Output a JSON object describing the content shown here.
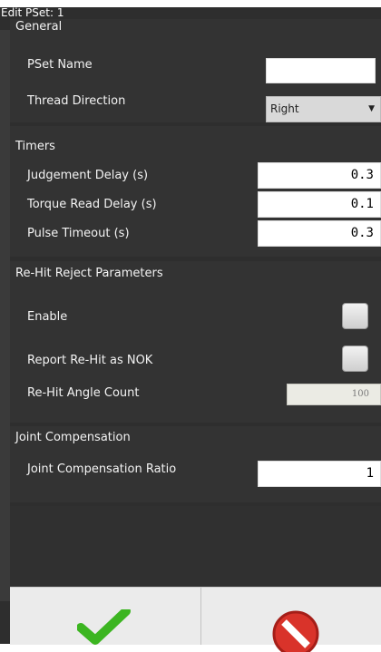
{
  "dialog": {
    "title": "Edit PSet: 1"
  },
  "general": {
    "header": "General",
    "pset_name_label": "PSet Name",
    "pset_name_value": "",
    "thread_direction_label": "Thread Direction",
    "thread_direction_value": "Right"
  },
  "timers": {
    "header": "Timers",
    "judgement_delay_label": "Judgement Delay (s)",
    "judgement_delay_value": "0.3",
    "torque_read_delay_label": "Torque Read Delay (s)",
    "torque_read_delay_value": "0.1",
    "pulse_timeout_label": "Pulse Timeout (s)",
    "pulse_timeout_value": "0.3"
  },
  "rehit": {
    "header": "Re-Hit Reject Parameters",
    "enable_label": "Enable",
    "report_label": "Report Re-Hit as NOK",
    "angle_count_label": "Re-Hit Angle Count",
    "angle_count_value": "100"
  },
  "joint": {
    "header": "Joint Compensation",
    "ratio_label": "Joint Compensation Ratio",
    "ratio_value": "1"
  },
  "footer": {
    "confirm_icon": "checkmark-icon",
    "cancel_icon": "cancel-icon",
    "confirm_color": "#3cb521",
    "cancel_color": "#d9332a"
  }
}
